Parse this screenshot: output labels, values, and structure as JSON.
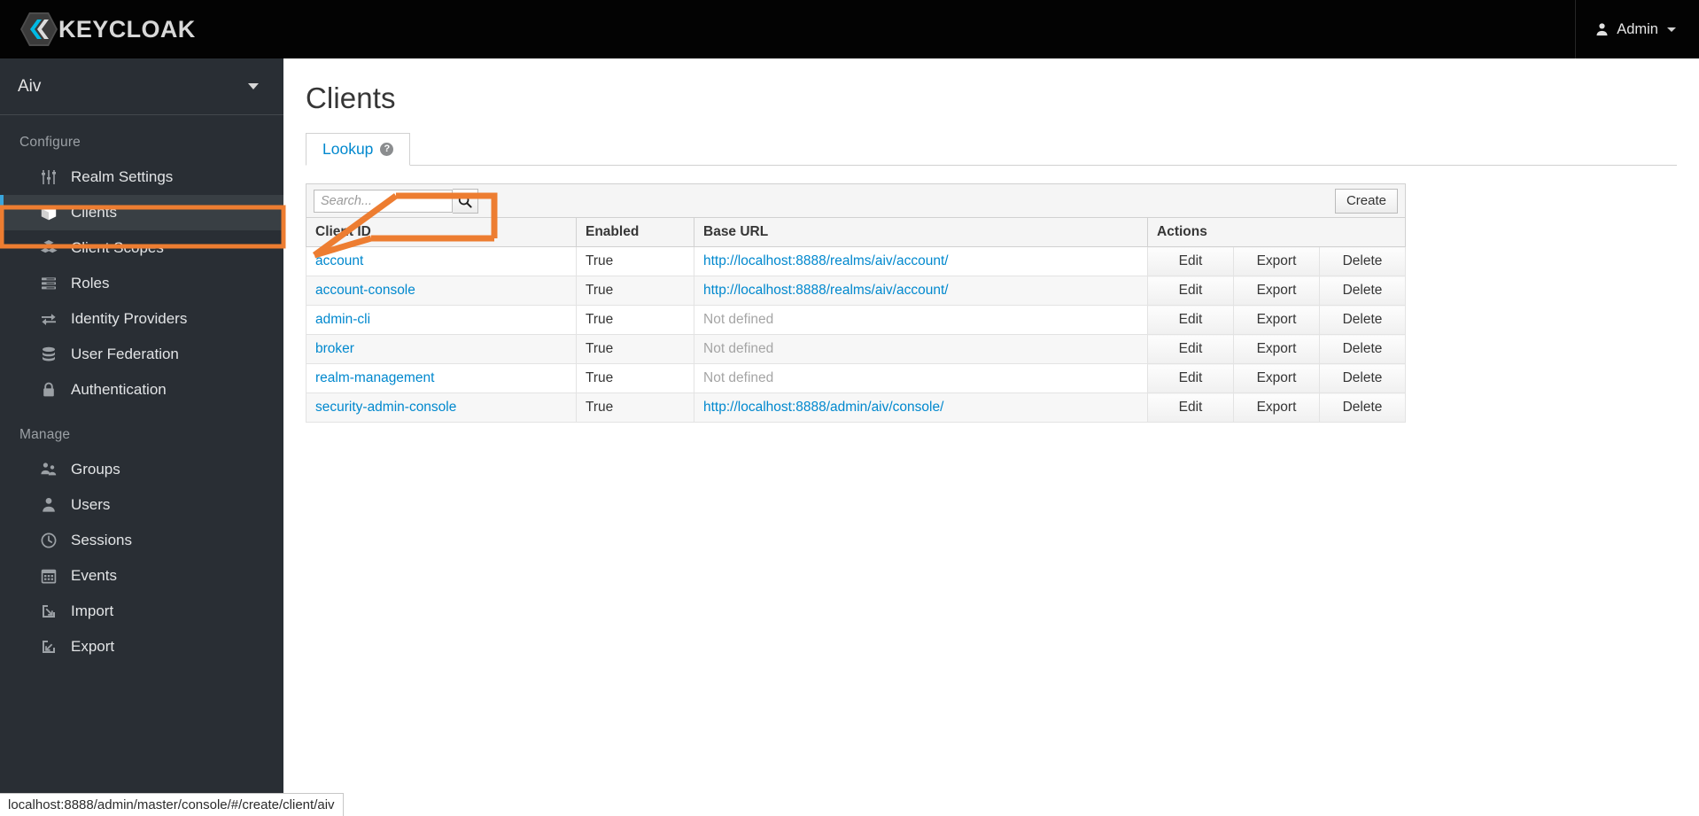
{
  "topbar": {
    "brand_name": "KEYCLOAK",
    "user_label": "Admin",
    "user_icon": "user-icon",
    "caret_icon": "chevron-down-icon"
  },
  "sidebar": {
    "realm_name": "Aiv",
    "realm_caret_icon": "chevron-down-icon",
    "sections": [
      {
        "label": "Configure",
        "items": [
          {
            "label": "Realm Settings",
            "icon": "sliders-icon",
            "active": false
          },
          {
            "label": "Clients",
            "icon": "cube-icon",
            "active": true
          },
          {
            "label": "Client Scopes",
            "icon": "cubes-icon",
            "active": false
          },
          {
            "label": "Roles",
            "icon": "list-icon",
            "active": false
          },
          {
            "label": "Identity Providers",
            "icon": "exchange-icon",
            "active": false
          },
          {
            "label": "User Federation",
            "icon": "database-icon",
            "active": false
          },
          {
            "label": "Authentication",
            "icon": "lock-icon",
            "active": false
          }
        ]
      },
      {
        "label": "Manage",
        "items": [
          {
            "label": "Groups",
            "icon": "users-icon",
            "active": false
          },
          {
            "label": "Users",
            "icon": "user-icon",
            "active": false
          },
          {
            "label": "Sessions",
            "icon": "clock-icon",
            "active": false
          },
          {
            "label": "Events",
            "icon": "calendar-icon",
            "active": false
          },
          {
            "label": "Import",
            "icon": "import-arrow-icon",
            "active": false
          },
          {
            "label": "Export",
            "icon": "export-arrow-icon",
            "active": false
          }
        ]
      }
    ]
  },
  "main": {
    "page_title": "Clients",
    "tabs": [
      {
        "label": "Lookup",
        "help_icon": "help-circle-icon",
        "active": true
      }
    ],
    "toolbar": {
      "search_placeholder": "Search...",
      "search_value": "",
      "search_icon": "search-icon",
      "create_label": "Create"
    },
    "table": {
      "columns": [
        "Client ID",
        "Enabled",
        "Base URL",
        "Actions"
      ],
      "action_labels": [
        "Edit",
        "Export",
        "Delete"
      ],
      "rows": [
        {
          "client_id": "account",
          "enabled": "True",
          "base_url": "http://localhost:8888/realms/aiv/account/",
          "base_url_defined": true
        },
        {
          "client_id": "account-console",
          "enabled": "True",
          "base_url": "http://localhost:8888/realms/aiv/account/",
          "base_url_defined": true
        },
        {
          "client_id": "admin-cli",
          "enabled": "True",
          "base_url": "Not defined",
          "base_url_defined": false
        },
        {
          "client_id": "broker",
          "enabled": "True",
          "base_url": "Not defined",
          "base_url_defined": false
        },
        {
          "client_id": "realm-management",
          "enabled": "True",
          "base_url": "Not defined",
          "base_url_defined": false
        },
        {
          "client_id": "security-admin-console",
          "enabled": "True",
          "base_url": "http://localhost:8888/admin/aiv/console/",
          "base_url_defined": true
        }
      ]
    }
  },
  "statusbar": {
    "url": "localhost:8888/admin/master/console/#/create/client/aiv"
  },
  "annotation": {
    "color": "#ED7D31",
    "highlight_target": "sidebar-item-clients",
    "arrow_points_to": "sidebar-item-clients"
  },
  "colors": {
    "topbar_bg": "#030303",
    "sidebar_bg": "#292e34",
    "sidebar_active_bg": "#393f44",
    "accent_blue": "#0088ce",
    "active_border": "#39a5dc",
    "annotation_orange": "#ED7D31"
  }
}
